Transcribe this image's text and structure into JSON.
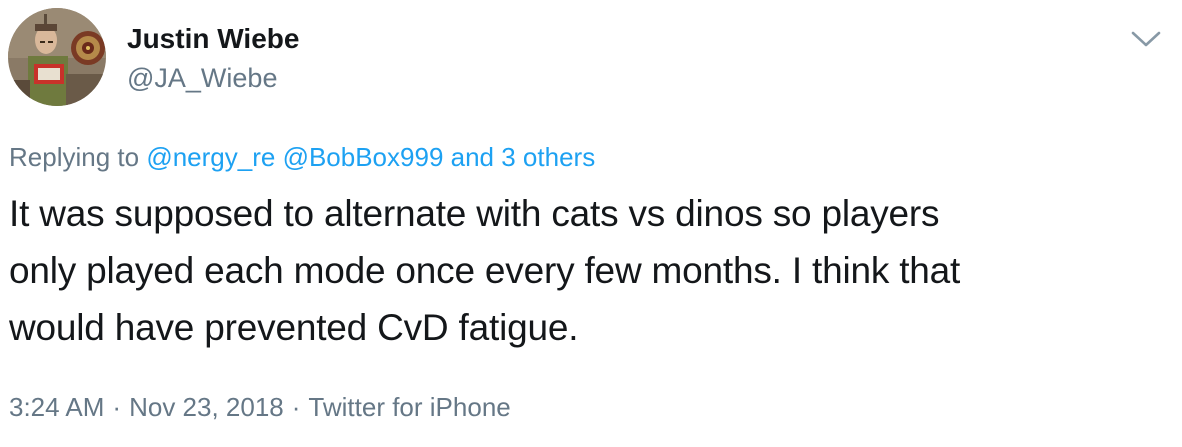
{
  "author": {
    "display_name": "Justin Wiebe",
    "handle": "@JA_Wiebe"
  },
  "reply": {
    "prefix": "Replying to",
    "mentions": [
      "@nergy_re",
      "@BobBox999"
    ],
    "others": "and 3 others"
  },
  "tweet": {
    "text": "It was supposed to alternate with cats vs dinos so players\nonly played each mode once every few months. I think that\nwould have prevented CvD fatigue."
  },
  "meta": {
    "time": "3:24 AM",
    "separator": "·",
    "date": "Nov 23, 2018",
    "source": "Twitter for iPhone"
  },
  "icons": {
    "menu": "chevron-down-icon",
    "avatar": "avatar"
  },
  "colors": {
    "link": "#1da1f2",
    "secondary_text": "#657786",
    "primary_text": "#14171a"
  }
}
